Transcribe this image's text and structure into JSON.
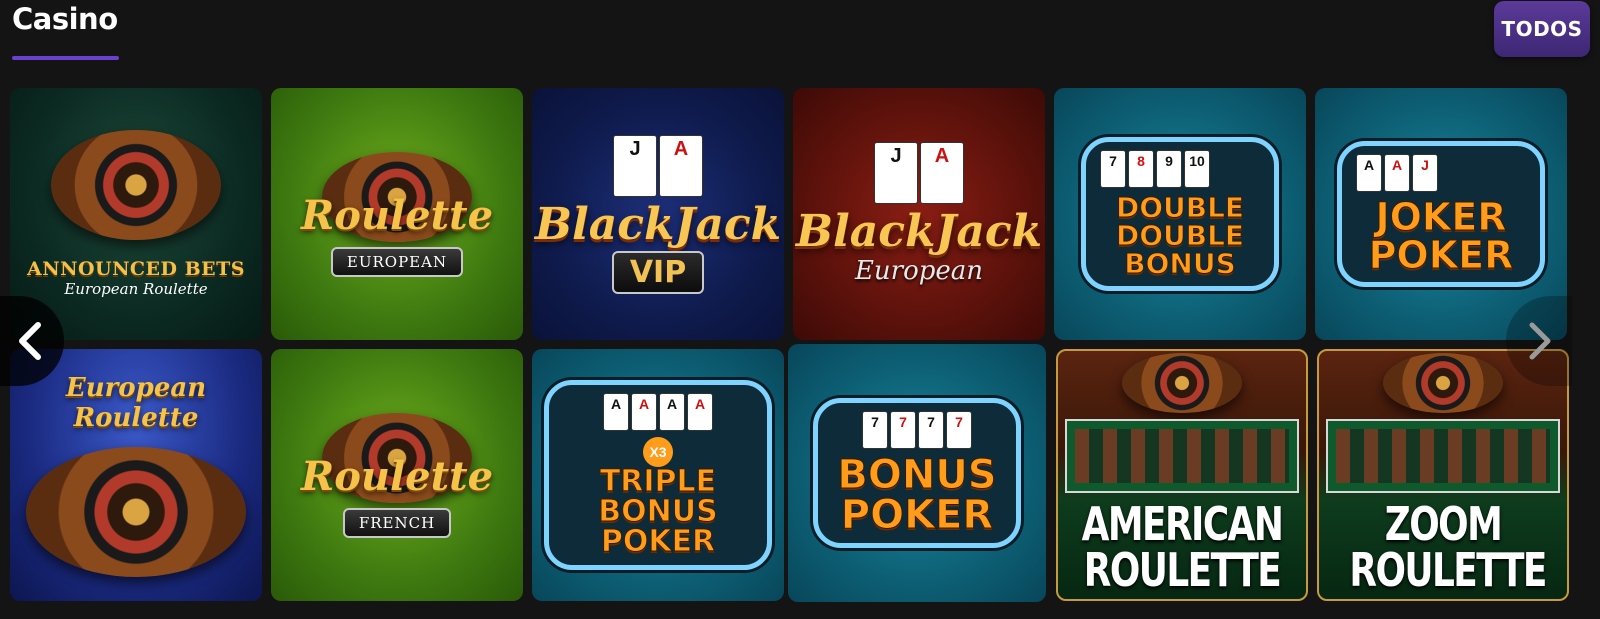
{
  "section": {
    "title": "Casino",
    "view_all_label": "TODOS"
  },
  "games": [
    {
      "title": "ANNOUNCED BETS",
      "subtitle": "European Roulette"
    },
    {
      "title": "Roulette",
      "subtitle": "EUROPEAN"
    },
    {
      "title": "BlackJack",
      "subtitle": "VIP"
    },
    {
      "title": "BlackJack",
      "subtitle": "European"
    },
    {
      "title": "DOUBLE DOUBLE BONUS",
      "cards": [
        "7",
        "8",
        "9",
        "10"
      ]
    },
    {
      "title": "JOKER POKER",
      "cards": [
        "A",
        "A",
        "J"
      ]
    },
    {
      "title": "European Roulette"
    },
    {
      "title": "Roulette",
      "subtitle": "FRENCH"
    },
    {
      "title": "TRIPLE BONUS POKER",
      "badge": "X3",
      "cards": [
        "A",
        "A",
        "A",
        "A"
      ]
    },
    {
      "title": "BONUS POKER",
      "cards": [
        "7",
        "7",
        "7",
        "7"
      ]
    },
    {
      "title": "AMERICAN ROULETTE"
    },
    {
      "title": "ZOOM ROULETTE"
    }
  ],
  "colors": {
    "accent": "#6b3fd0",
    "background": "#141414"
  },
  "icons": {
    "prev": "chevron-left-icon",
    "next": "chevron-right-icon"
  }
}
